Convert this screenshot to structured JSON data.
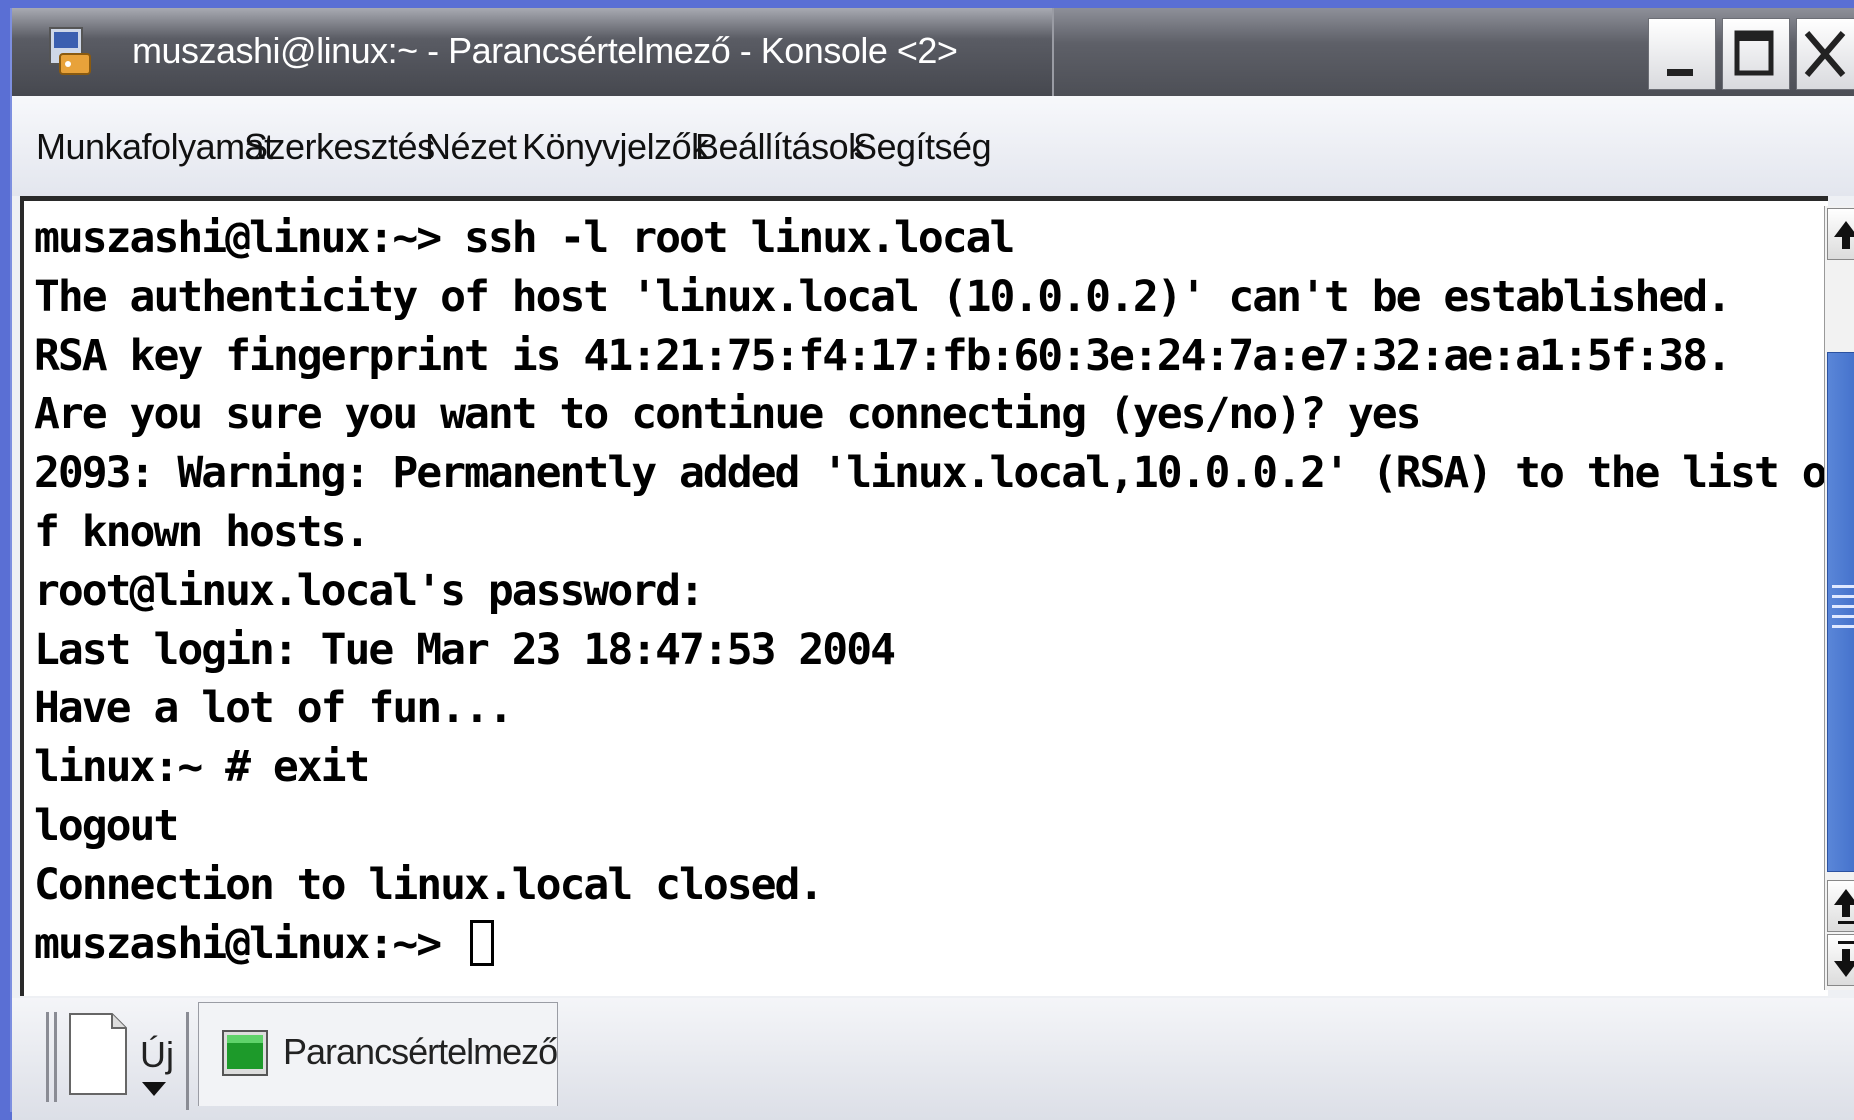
{
  "window": {
    "title": "muszashi@linux:~ - Parancsértelmező - Konsole <2>",
    "controls": [
      "minimize",
      "maximize",
      "close"
    ]
  },
  "menubar": {
    "items": [
      "Munkafolyamat",
      "Szerkesztés",
      "Nézet",
      "Könyvjelzők",
      "Beállítások",
      "Segítség"
    ]
  },
  "terminal": {
    "lines": [
      "muszashi@linux:~> ssh -l root linux.local",
      "The authenticity of host 'linux.local (10.0.0.2)' can't be established.",
      "RSA key fingerprint is 41:21:75:f4:17:fb:60:3e:24:7a:e7:32:ae:a1:5f:38.",
      "Are you sure you want to continue connecting (yes/no)? yes",
      "2093: Warning: Permanently added 'linux.local,10.0.0.2' (RSA) to the list o",
      "f known hosts.",
      "root@linux.local's password:",
      "Last login: Tue Mar 23 18:47:53 2004",
      "Have a lot of fun...",
      "linux:~ # exit",
      "logout",
      "Connection to linux.local closed.",
      "muszashi@linux:~> "
    ]
  },
  "tabbar": {
    "new_label": "Új",
    "tabs": [
      {
        "label": "Parancsértelmező",
        "icon": "terminal-icon"
      }
    ]
  },
  "colors": {
    "desktop": "#5a6fd4",
    "titlebar": "#4d4f56",
    "scroll_thumb": "#3e6cc8",
    "terminal_bg": "#ffffff",
    "terminal_fg": "#000000"
  }
}
